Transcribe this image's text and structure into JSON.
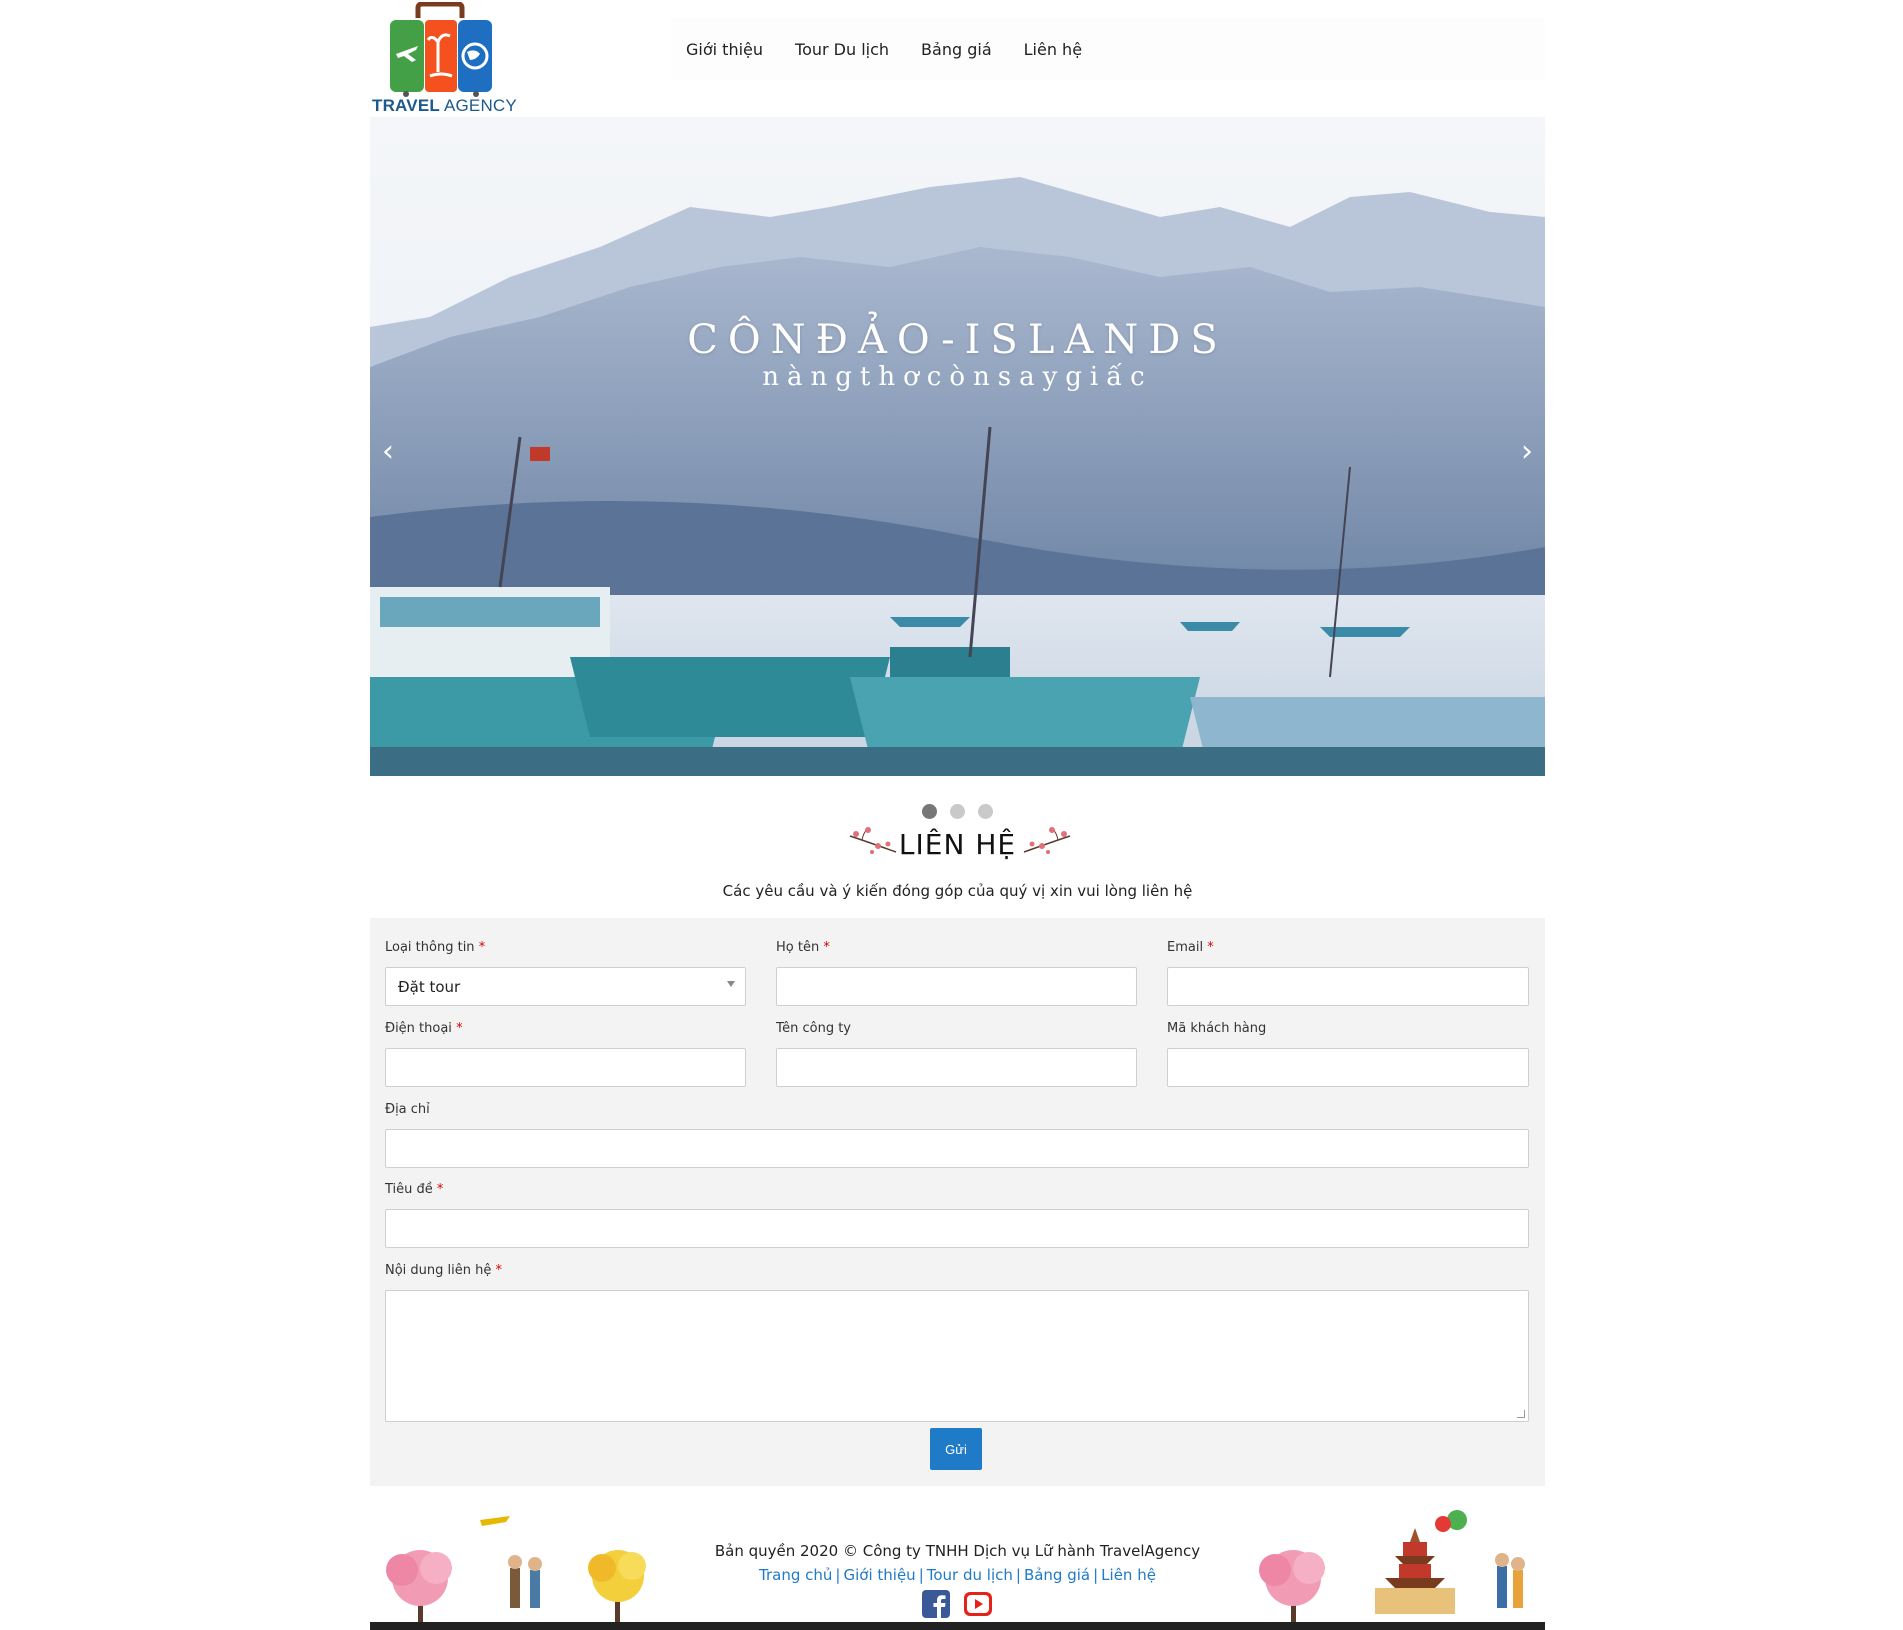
{
  "brand": {
    "logo_word_bold": "TRAVEL",
    "logo_word_light": " AGENCY"
  },
  "nav": {
    "items": [
      "Giới thiệu",
      "Tour Du lịch",
      "Bảng giá",
      "Liên hệ"
    ]
  },
  "slider": {
    "title": "CÔNĐẢO-ISLANDS",
    "subtitle": "nàngthơcònsaygiấc",
    "prev_label": "‹",
    "next_label": "›",
    "slide_count": 3,
    "active_slide": 1
  },
  "contact": {
    "heading": "LIÊN HỆ",
    "description": "Các yêu cầu và ý kiến đóng góp của quý vị xin vui lòng liên hệ",
    "required_mark": "*",
    "fields": {
      "type": {
        "label": "Loại thông tin",
        "value": "Đặt tour"
      },
      "name": {
        "label": "Họ tên"
      },
      "email": {
        "label": "Email"
      },
      "phone": {
        "label": "Điện thoại"
      },
      "company": {
        "label": "Tên công ty"
      },
      "customer_code": {
        "label": "Mã khách hàng"
      },
      "address": {
        "label": "Địa chỉ"
      },
      "subject": {
        "label": "Tiêu đề"
      },
      "message": {
        "label": "Nội dung liên hệ"
      }
    },
    "submit_label": "Gửi"
  },
  "footer": {
    "copyright": "Bản quyền 2020 © Công ty TNHH Dịch vụ Lữ hành TravelAgency",
    "links": [
      "Trang chủ",
      "Giới thiệu",
      "Tour du lịch",
      "Bảng giá",
      "Liên hệ"
    ],
    "link_separator": "|",
    "social_icons": [
      "facebook-icon",
      "youtube-icon"
    ]
  },
  "colors": {
    "accent": "#1f7ac7",
    "required": "#dd0000",
    "form_bg": "#f3f3f3",
    "facebook": "#3b5998",
    "youtube": "#e62117"
  }
}
